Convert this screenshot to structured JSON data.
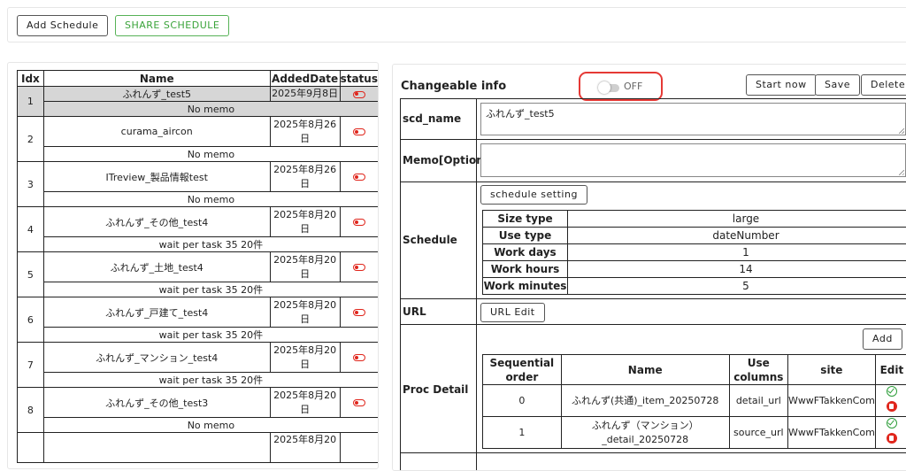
{
  "toolbar": {
    "add_schedule_label": "Add Schedule",
    "share_schedule_label": "SHARE SCHEDULE"
  },
  "schedule_list": {
    "columns": [
      "Idx",
      "Name",
      "AddedDate",
      "status"
    ],
    "rows": [
      {
        "idx": "1",
        "name": "ふれんず_test5",
        "date": "2025年9月8日",
        "memo": "No memo",
        "status": "off"
      },
      {
        "idx": "2",
        "name": "curama_aircon",
        "date": "2025年8月26日",
        "memo": "No memo",
        "status": "off"
      },
      {
        "idx": "3",
        "name": "ITreview_製品情報test",
        "date": "2025年8月26日",
        "memo": "No memo",
        "status": "off"
      },
      {
        "idx": "4",
        "name": "ふれんず_その他_test4",
        "date": "2025年8月20日",
        "memo": "wait per task 35 20件",
        "status": "off"
      },
      {
        "idx": "5",
        "name": "ふれんず_土地_test4",
        "date": "2025年8月20日",
        "memo": "wait per task 35 20件",
        "status": "off"
      },
      {
        "idx": "6",
        "name": "ふれんず_戸建て_test4",
        "date": "2025年8月20日",
        "memo": "wait per task 35 20件",
        "status": "off"
      },
      {
        "idx": "7",
        "name": "ふれんず_マンション_test4",
        "date": "2025年8月20日",
        "memo": "wait per task 35 20件",
        "status": "off"
      },
      {
        "idx": "8",
        "name": "ふれんず_その他_test3",
        "date": "2025年8月20日",
        "memo": "No memo",
        "status": "off"
      },
      {
        "idx": "",
        "name": "",
        "date": "2025年8月20",
        "memo": "",
        "status": ""
      }
    ]
  },
  "detail": {
    "title": "Changeable info",
    "toggle_label": "OFF",
    "start_now_label": "Start now",
    "save_label": "Save",
    "delete_label": "Delete",
    "scd_name_label": "scd_name",
    "scd_name_value": "ふれんず_test5",
    "memo_label": "Memo[Option]",
    "memo_value": "",
    "schedule_label": "Schedule",
    "schedule_setting_label": "schedule setting",
    "schedule_rows": [
      {
        "key": "Size type",
        "value": "large"
      },
      {
        "key": "Use type",
        "value": "dateNumber"
      },
      {
        "key": "Work days",
        "value": "1"
      },
      {
        "key": "Work hours",
        "value": "14"
      },
      {
        "key": "Work minutes",
        "value": "5"
      }
    ],
    "url_label": "URL",
    "url_edit_label": "URL Edit",
    "proc_label": "Proc Detail",
    "add_label": "Add",
    "proc_columns": [
      "Sequential order",
      "Name",
      "Use columns",
      "site",
      "Edit"
    ],
    "proc_rows": [
      {
        "order": "0",
        "name": "ふれんず(共通)_item_20250728",
        "column": "detail_url",
        "site": "WwwFTakkenCom"
      },
      {
        "order": "1",
        "name": "ふれんず（マンション）_detail_20250728",
        "column": "source_url",
        "site": "WwwFTakkenCom"
      }
    ]
  },
  "colors": {
    "accent_green": "#3aa33a",
    "status_red": "#e0261c",
    "highlight_red": "#e53935",
    "selected_row": "#d6d6d6"
  }
}
